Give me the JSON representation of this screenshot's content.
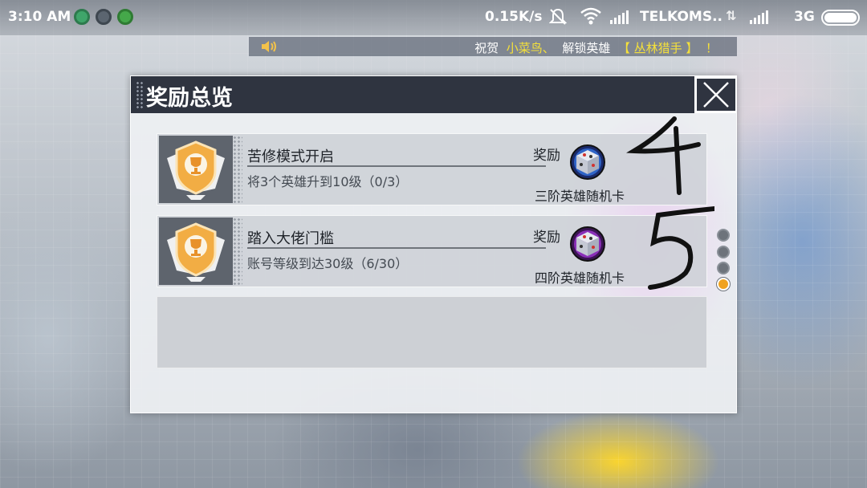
{
  "status_bar": {
    "time": "3:10 AM",
    "speed": "0.15K/s",
    "carrier": "TELKOMS..",
    "network_type": "3G",
    "icons": [
      "shield-app-icon",
      "mask-app-icon",
      "frog-app-icon",
      "mute-icon",
      "wifi-icon",
      "signal-icon",
      "data-arrows-icon",
      "signal-icon",
      "battery-icon"
    ]
  },
  "announcement": {
    "prefix": "祝贺",
    "player": "小菜鸟、",
    "action": "解锁英雄",
    "hero": "【 丛林猎手 】",
    "suffix": "！",
    "icon": "speaker-icon"
  },
  "dialog": {
    "title": "奖励总览",
    "close_icon": "close-icon"
  },
  "tasks": [
    {
      "title": "苦修模式开启",
      "description": "将3个英雄升到10级（0/3）",
      "reward_label": "奖励",
      "reward_name": "三阶英雄随机卡",
      "reward_icon": "blue-dice-card-icon",
      "badge_icon": "trophy-badge-icon"
    },
    {
      "title": "踏入大佬门槛",
      "description": "账号等级到达30级（6/30）",
      "reward_label": "奖励",
      "reward_name": "四阶英雄随机卡",
      "reward_icon": "purple-dice-card-icon",
      "badge_icon": "trophy-badge-icon"
    }
  ],
  "pagination": {
    "total_pages": 4,
    "active_page": 4
  },
  "colors": {
    "header_bg": "#2f3440",
    "announcement_highlight": "#f5e13a",
    "active_dot": "#f0a21e",
    "badge_gold": "#f0a63a"
  }
}
